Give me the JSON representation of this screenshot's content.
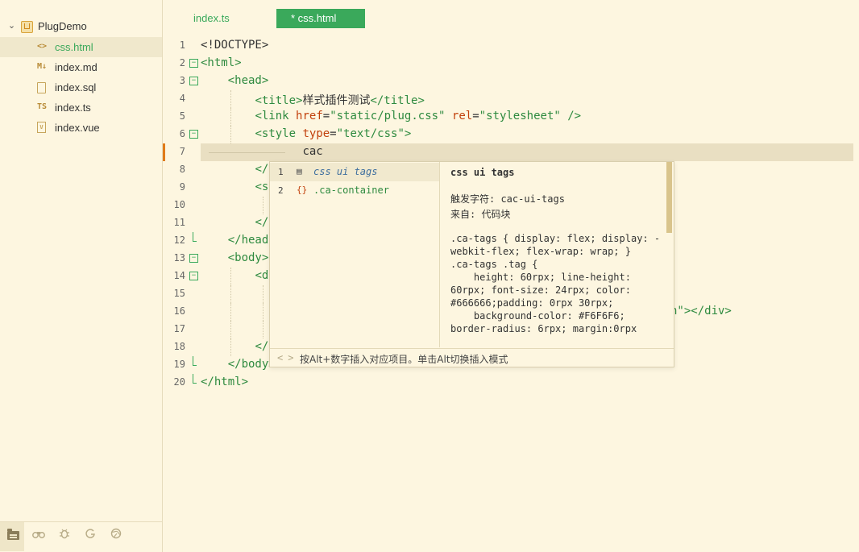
{
  "sidebar": {
    "project": "PlugDemo",
    "files": [
      {
        "name": "css.html",
        "icon": "<>",
        "active": true
      },
      {
        "name": "index.md",
        "icon": "M↓"
      },
      {
        "name": "index.sql",
        "icon": "doc"
      },
      {
        "name": "index.ts",
        "icon": "TS"
      },
      {
        "name": "index.vue",
        "icon": "V"
      }
    ]
  },
  "tabs": [
    {
      "label": "index.ts"
    },
    {
      "label": "* css.html",
      "active": true
    }
  ],
  "editor": {
    "line_numbers": [
      "1",
      "2",
      "3",
      "4",
      "5",
      "6",
      "7",
      "8",
      "9",
      "10",
      "11",
      "12",
      "13",
      "14",
      "15",
      "16",
      "17",
      "18",
      "19",
      "20"
    ],
    "current_line": 7,
    "typed_text": "cac",
    "line1": "<!DOCTYPE>",
    "line2_tag": "<html>",
    "line3_tag": "<head>",
    "line4_open": "<title>",
    "line4_text": "样式插件测试",
    "line4_close": "</title>",
    "line5_tag": "<link",
    "line5_attr1": "href",
    "line5_val1": "\"static/plug.css\"",
    "line5_attr2": "rel",
    "line5_val2": "\"stylesheet\"",
    "line5_end": "/>",
    "line6_tag": "<style",
    "line6_attr": "type",
    "line6_val": "\"text/css\"",
    "line6_end": ">",
    "line8": "</",
    "line9": "<s",
    "line11": "</",
    "line12": "</head",
    "line13": "<body>",
    "line14": "<d",
    "line16_tail": "n\"></div>",
    "line18": "</",
    "line19": "</body>",
    "line20": "</html>"
  },
  "autocomplete": {
    "suggestions": [
      {
        "index": "1",
        "icon": "snippet",
        "text": "css ui tags"
      },
      {
        "index": "2",
        "icon": "{}",
        "text": ".ca-container"
      }
    ],
    "detail_title": "css ui tags",
    "trigger": "触发字符: cac-ui-tags",
    "source": "来自: 代码块",
    "body": ".ca-tags { display: flex; display: -webkit-flex; flex-wrap: wrap; }\n.ca-tags .tag {\n    height: 60rpx; line-height: 60rpx; font-size: 24rpx; color: #666666;padding: 0rpx 30rpx;\n    background-color: #F6F6F6; border-radius: 6rpx; margin:0rpx",
    "nav_prev": "<",
    "nav_next": ">",
    "hint": "按Alt+数字插入对应项目。单击Alt切换插入模式"
  },
  "colors": {
    "background": "#fdf6e0",
    "accent": "#3aa95b",
    "tag": "#2e8a3f",
    "attr": "#c2410c",
    "cursor_marker": "#e07b1a"
  }
}
